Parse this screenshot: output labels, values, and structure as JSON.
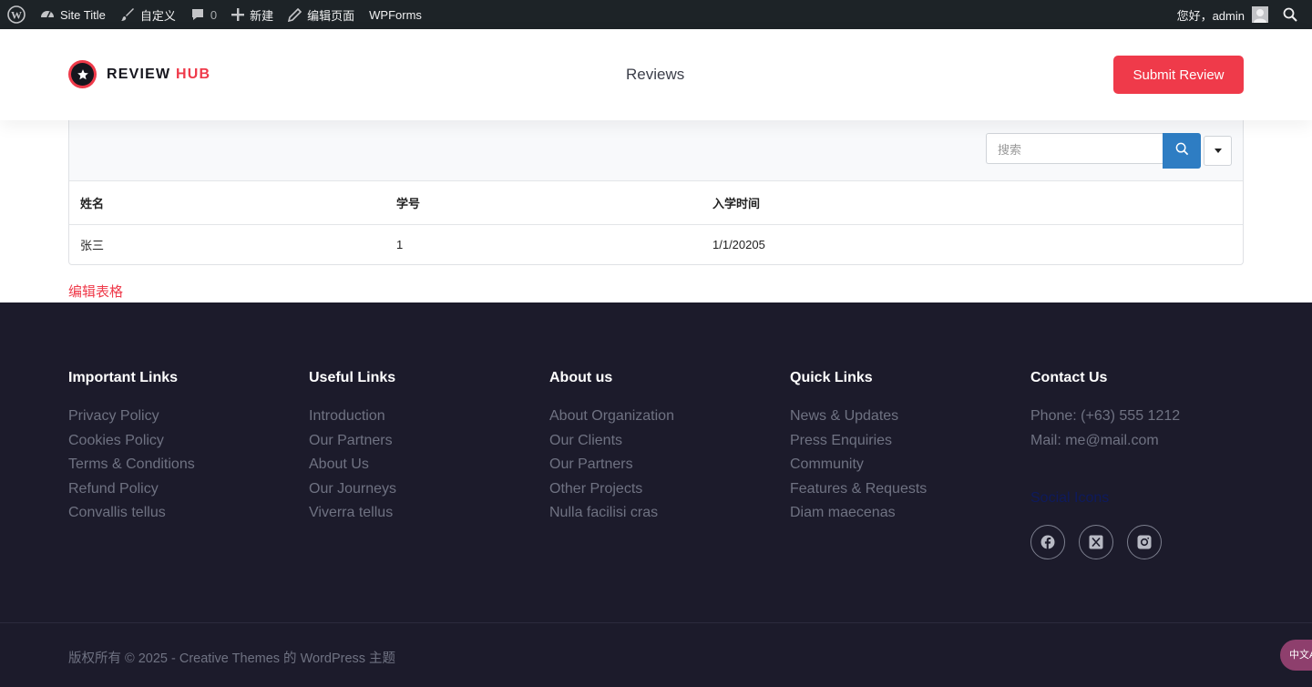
{
  "admin_bar": {
    "site_title": "Site Title",
    "customize": "自定义",
    "comments_count": "0",
    "new": "新建",
    "edit_page": "编辑页面",
    "wpforms": "WPForms",
    "greeting": "您好，admin"
  },
  "header": {
    "logo_word": "REVIEW",
    "logo_accent": "HUB",
    "nav_reviews": "Reviews",
    "submit_label": "Submit Review"
  },
  "table": {
    "search_placeholder": "搜索",
    "columns": [
      "姓名",
      "学号",
      "入学时间"
    ],
    "rows": [
      [
        "张三",
        "1",
        "1/1/20205"
      ]
    ],
    "edit_link": "编辑表格"
  },
  "footer": {
    "columns": [
      {
        "heading": "Important Links",
        "links": [
          "Privacy Policy",
          "Cookies Policy",
          "Terms & Conditions",
          "Refund Policy",
          "Convallis tellus"
        ]
      },
      {
        "heading": "Useful Links",
        "links": [
          "Introduction",
          "Our Partners",
          "About Us",
          "Our Journeys",
          "Viverra tellus"
        ]
      },
      {
        "heading": "About us",
        "links": [
          "About Organization",
          "Our Clients",
          "Our Partners",
          "Other Projects",
          "Nulla facilisi cras"
        ]
      },
      {
        "heading": "Quick Links",
        "links": [
          "News & Updates",
          "Press Enquiries",
          "Community",
          "Features & Requests",
          "Diam maecenas"
        ]
      },
      {
        "heading": "Contact Us",
        "links": [
          "Phone: (+63) 555 1212",
          "Mail: me@mail.com"
        ]
      }
    ],
    "social_heading": "Social Icons",
    "social_icons": [
      "facebook-icon",
      "x-icon",
      "instagram-icon"
    ],
    "copyright": "版权所有 © 2025 - Creative Themes 的 WordPress 主题",
    "translate_label": "中文A"
  },
  "colors": {
    "accent": "#ef3a4a",
    "admin_bar_bg": "#1d2327",
    "footer_bg": "#1c1b2b",
    "search_button": "#2e7dc3"
  }
}
